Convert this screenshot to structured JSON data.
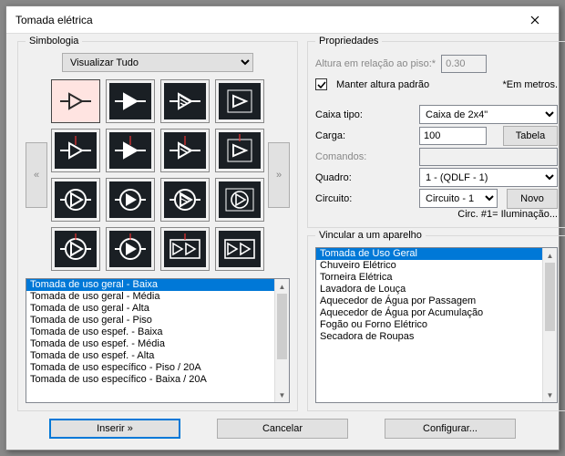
{
  "title": "Tomada elétrica",
  "left": {
    "group": "Simbologia",
    "viewCombo": "Visualizar Tudo",
    "prevGlyph": "«",
    "nextGlyph": "»",
    "list": [
      "Tomada de uso geral - Baixa",
      "Tomada de uso geral - Média",
      "Tomada de uso geral - Alta",
      "Tomada de uso geral - Piso",
      "Tomada de uso espef. - Baixa",
      "Tomada de uso espef. - Média",
      "Tomada de uso espef. - Alta",
      "Tomada de uso específico - Piso / 20A",
      "Tomada de uso específico - Baixa / 20A"
    ]
  },
  "props": {
    "group": "Propriedades",
    "alturaLabel": "Altura em relação ao piso:*",
    "alturaValue": "0.30",
    "manterAltura": "Manter altura padrão",
    "metrosNote": "*Em metros.",
    "caixaLabel": "Caixa tipo:",
    "caixaValue": "Caixa de 2x4\"",
    "cargaLabel": "Carga:",
    "cargaValue": "100",
    "tabela": "Tabela",
    "comandosLabel": "Comandos:",
    "comandosValue": "",
    "quadroLabel": "Quadro:",
    "quadroValue": "1 - (QDLF - 1)",
    "circuitoLabel": "Circuito:",
    "circuitoValue": "Circuito - 1",
    "novo": "Novo",
    "circNote": "Circ. #1= Iluminação..."
  },
  "link": {
    "group": "Vincular a um aparelho",
    "items": [
      "Tomada de Uso Geral",
      "Chuveiro Elétrico",
      "Torneira Elétrica",
      "Lavadora de Louça",
      "Aquecedor de Água por Passagem",
      "Aquecedor de Água por Acumulação",
      "Fogão ou Forno Elétrico",
      "Secadora de Roupas"
    ]
  },
  "buttons": {
    "insert": "Inserir »",
    "cancel": "Cancelar",
    "config": "Configurar..."
  }
}
